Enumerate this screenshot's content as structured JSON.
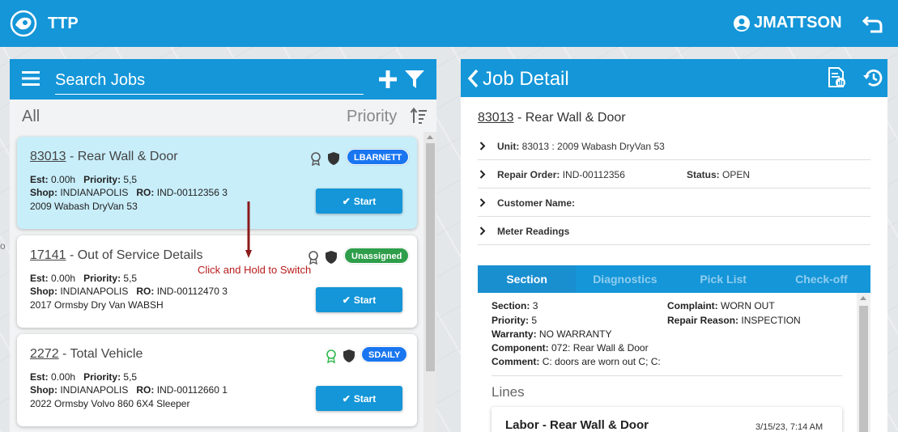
{
  "app": {
    "title": "TTP",
    "user": "JMATTSON"
  },
  "colors": {
    "primary": "#1496d8",
    "selected_card": "#c8eefa",
    "badge_blue": "#1976f0",
    "badge_green": "#2e9e4a",
    "hint_red": "#b71c1c"
  },
  "left": {
    "search_placeholder": "Search Jobs",
    "filter_label": "All",
    "sort_label": "Priority",
    "icons": [
      "menu-icon",
      "add-icon",
      "filter-icon",
      "sort-icon"
    ]
  },
  "jobs": [
    {
      "number": "83013",
      "title": " - Rear Wall & Door",
      "est_label": "Est:",
      "est": "0.00h",
      "priority_label": "Priority:",
      "priority": "5,5",
      "shop_label": "Shop:",
      "shop": "INDIANAPOLIS",
      "ro_label": "RO:",
      "ro": "IND-00112356 3",
      "vehicle": "2009 Wabash DryVan 53",
      "badge": "LBARNETT",
      "start": "Start"
    },
    {
      "number": "17141",
      "title": " - Out of Service Details",
      "est_label": "Est:",
      "est": "0.00h",
      "priority_label": "Priority:",
      "priority": "5,5",
      "shop_label": "Shop:",
      "shop": "INDIANAPOLIS",
      "ro_label": "RO:",
      "ro": "IND-00112470 3",
      "vehicle": "2017 Ormsby Dry Van WABSH",
      "badge": "Unassigned",
      "start": "Start"
    },
    {
      "number": "2272",
      "title": " - Total Vehicle",
      "est_label": "Est:",
      "est": "0.00h",
      "priority_label": "Priority:",
      "priority": "5,5",
      "shop_label": "Shop:",
      "shop": "INDIANAPOLIS",
      "ro_label": "RO:",
      "ro": "IND-00112660 1",
      "vehicle": "2022 Ormsby Volvo 860 6X4 Sleeper",
      "badge": "SDAILY",
      "start": "Start"
    }
  ],
  "hint": "Click and Hold to Switch",
  "detail": {
    "header": "Job Detail",
    "job_number": "83013",
    "job_title": " - Rear Wall & Door",
    "unit_label": "Unit:",
    "unit": "83013 : 2009 Wabash DryVan 53",
    "ro_label": "Repair Order:",
    "ro": "IND-00112356",
    "status_label": "Status:",
    "status": "OPEN",
    "customer_label": "Customer Name:",
    "meter_label": "Meter Readings",
    "tabs": [
      "Section",
      "Diagnostics",
      "Pick List",
      "Check-off"
    ],
    "section": {
      "section_label": "Section:",
      "section": "3",
      "priority_label": "Priority:",
      "priority": "5",
      "warranty_label": "Warranty:",
      "warranty": "NO WARRANTY",
      "component_label": "Component:",
      "component": "072: Rear Wall & Door",
      "comment_label": "Comment:",
      "comment": "C: doors are worn out C; C:",
      "complaint_label": "Complaint:",
      "complaint": "WORN OUT",
      "reason_label": "Repair Reason:",
      "reason": "INSPECTION"
    },
    "lines_title": "Lines",
    "labor_title": "Labor - Rear Wall & Door",
    "labor_date": "3/15/23, 7:14 AM"
  }
}
